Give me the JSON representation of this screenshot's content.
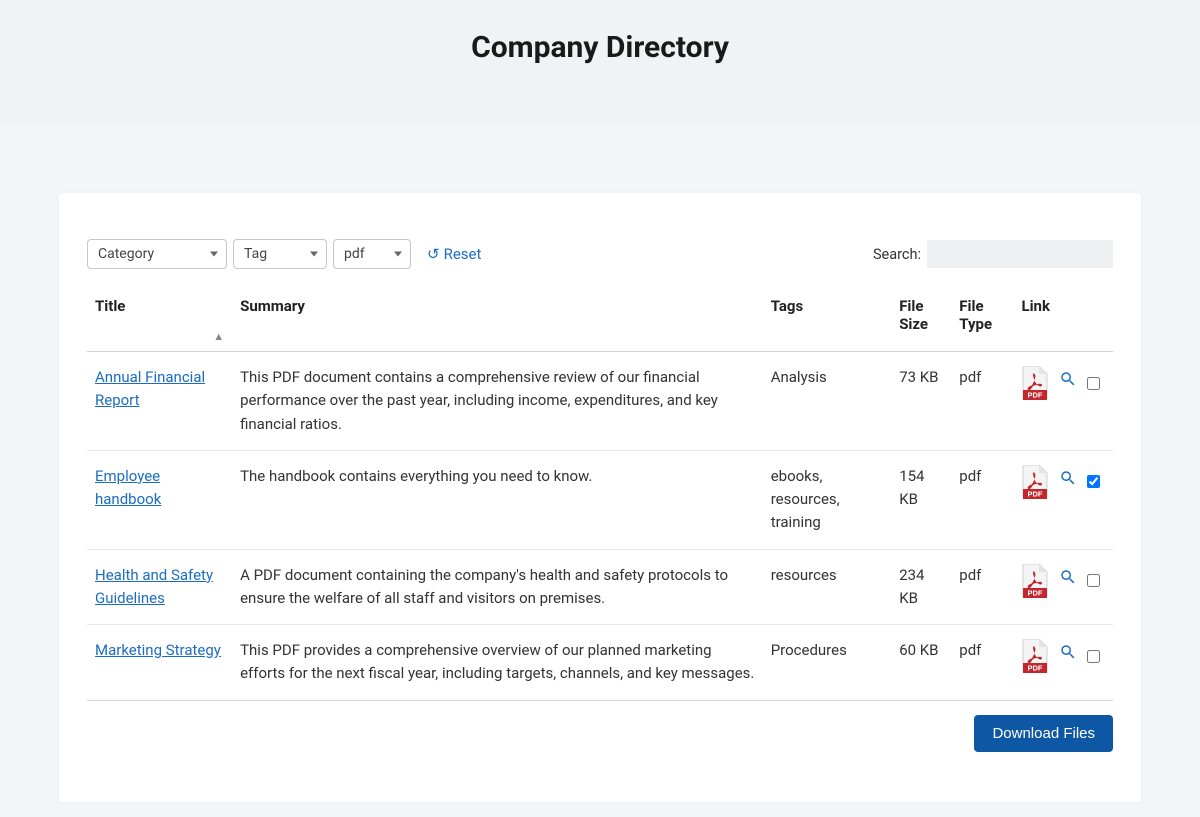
{
  "header": {
    "title": "Company Directory"
  },
  "filters": {
    "category_label": "Category",
    "tag_label": "Tag",
    "type_label": "pdf",
    "reset_label": "Reset",
    "search_label": "Search:",
    "search_value": ""
  },
  "columns": {
    "title": "Title",
    "summary": "Summary",
    "tags": "Tags",
    "size": "File Size",
    "type": "File Type",
    "link": "Link"
  },
  "rows": [
    {
      "title": "Annual Financial Report",
      "summary": "This PDF document contains a comprehensive review of our financial performance over the past year, including income, expenditures, and key financial ratios.",
      "tags": "Analysis",
      "size": "73 KB",
      "type": "pdf",
      "checked": false
    },
    {
      "title": "Employee handbook",
      "summary": "The handbook contains everything you need to know.",
      "tags": "ebooks, resources, training",
      "size": "154 KB",
      "type": "pdf",
      "checked": true
    },
    {
      "title": "Health and Safety Guidelines",
      "summary": "A PDF document containing the company's health and safety protocols to ensure the welfare of all staff and visitors on premises.",
      "tags": "resources",
      "size": "234 KB",
      "type": "pdf",
      "checked": false
    },
    {
      "title": "Marketing Strategy",
      "summary": "This PDF provides a comprehensive overview of our planned marketing efforts for the next fiscal year, including targets, channels, and key messages.",
      "tags": "Procedures",
      "size": "60 KB",
      "type": "pdf",
      "checked": false
    }
  ],
  "download_label": "Download Files"
}
